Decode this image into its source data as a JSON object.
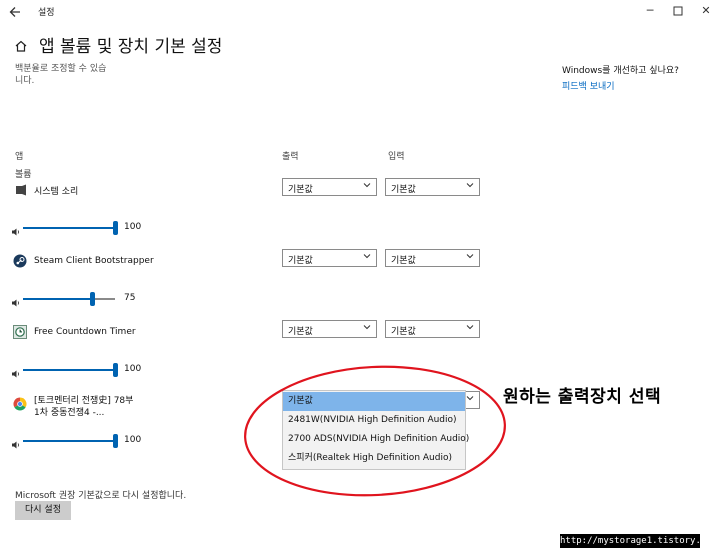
{
  "window": {
    "title": "설정"
  },
  "page": {
    "title": "앱 볼륨 및 장치 기본 설정",
    "description_line1": "백분율로 조정할 수 있습",
    "description_line2": "니다."
  },
  "feedback": {
    "question": "Windows를 개선하고 싶나요?",
    "link": "피드백 보내기"
  },
  "columns": {
    "app": "앱",
    "output": "출력",
    "input": "입력"
  },
  "volume_label": "볼륨",
  "apps": [
    {
      "name": "시스템 소리",
      "output": "기본값",
      "input": "기본값",
      "volume": 100,
      "volume_text": "100",
      "icon": "system-sounds-icon"
    },
    {
      "name": "Steam Client Bootstrapper",
      "output": "기본값",
      "input": "기본값",
      "volume": 75,
      "volume_text": "75",
      "icon": "steam-icon"
    },
    {
      "name": "Free Countdown Timer",
      "output": "기본값",
      "input": "기본값",
      "volume": 100,
      "volume_text": "100",
      "icon": "timer-icon"
    },
    {
      "name_line1": "[토크멘터리 전쟁史] 78부",
      "name_line2": "1차 중동전쟁4 -...",
      "output": "기본값",
      "volume": 100,
      "volume_text": "100",
      "icon": "chrome-icon"
    }
  ],
  "dropdown": {
    "options": [
      "기본값",
      "2481W(NVIDIA High Definition Audio)",
      "2700 ADS(NVIDIA High Definition Audio)",
      "스피커(Realtek High Definition Audio)"
    ],
    "selected_index": 0
  },
  "annotation": "원하는 출력장치 선택",
  "footer": {
    "reset_text": "Microsoft 권장 기본값으로 다시 설정합니다.",
    "reset_button": "다시 설정"
  },
  "watermark": "http://mystorage1.tistory.com",
  "colors": {
    "accent": "#0063b1",
    "highlight": "#7eb4ea",
    "annotation_ring": "#e0141e",
    "link": "#0067c0"
  }
}
